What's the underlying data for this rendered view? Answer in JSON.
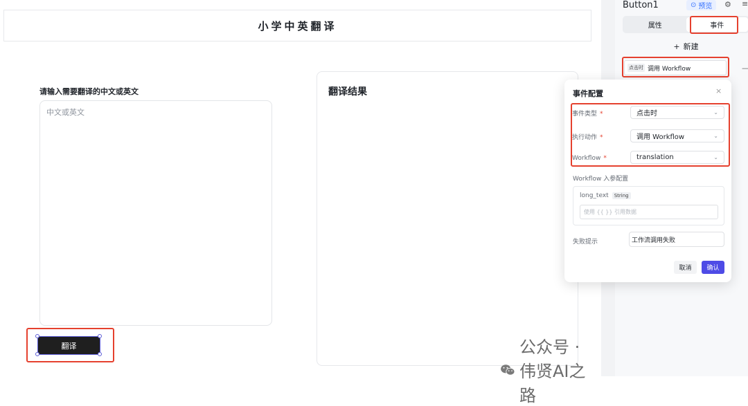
{
  "canvas": {
    "header_title": "小学中英翻译",
    "input_label": "请输入需要翻译的中文或英文",
    "input_placeholder": "中文或英文",
    "result_title": "翻译结果",
    "translate_button": "翻译"
  },
  "panel": {
    "component_name": "Button1",
    "preview_label": "预览",
    "tabs": [
      "属性",
      "事件"
    ],
    "active_tab": "事件",
    "new_label": "新建",
    "event_item": {
      "trigger_tag": "点击时",
      "action": "调用 Workflow"
    }
  },
  "modal": {
    "title": "事件配置",
    "fields": [
      {
        "label": "事件类型",
        "value": "点击时"
      },
      {
        "label": "执行动作",
        "value": "调用 Workflow"
      },
      {
        "label": "Workflow",
        "value": "translation"
      }
    ],
    "params_section": "Workflow 入参配置",
    "param_name": "long_text",
    "param_type": "String",
    "param_placeholder": "使用 {{ }} 引用数据",
    "fail_label": "失败提示",
    "fail_value": "工作流调用失败",
    "cancel": "取消",
    "confirm": "确认"
  },
  "watermark": {
    "text": "公众号 · 伟贤AI之路",
    "icon": "wechat-icon"
  },
  "colors": {
    "accent": "#4e4be6",
    "highlight_box": "#e5402e",
    "preview_blue": "#3370ff"
  }
}
